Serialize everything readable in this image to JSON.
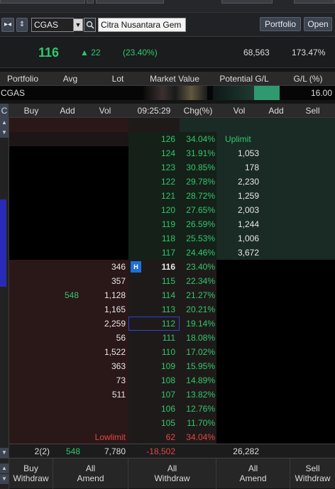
{
  "toolbar": {
    "symbol": "CGAS",
    "search_icon": "search-icon",
    "company_name": "Citra Nusantara Gem",
    "portfolio_label": "Portfolio",
    "open_label": "Open"
  },
  "quote": {
    "price": "116",
    "change": "▲ 22",
    "change_pct": "(23.40%)",
    "volume": "68,563",
    "pct2": "173.47%"
  },
  "portfolio_header": {
    "portfolio": "Portfolio",
    "avg": "Avg",
    "lot": "Lot",
    "market_value": "Market Value",
    "potential": "Potential G/L",
    "gl_pct": "G/L (%)"
  },
  "portfolio_row": {
    "code": "CGAS",
    "gl_pct": "16.00"
  },
  "book_header": {
    "c_btn": "C",
    "buy": "Buy",
    "add": "Add",
    "vol": "Vol",
    "time": "09:25:29",
    "chg": "Chg(%)",
    "vol2": "Vol",
    "add2": "Add",
    "sell": "Sell"
  },
  "book_rows": [
    {
      "price": "126",
      "chg": "34.04%",
      "ask_vol": "Uplimit"
    },
    {
      "price": "124",
      "chg": "31.91%",
      "ask_vol": "1,053"
    },
    {
      "price": "123",
      "chg": "30.85%",
      "ask_vol": "178"
    },
    {
      "price": "122",
      "chg": "29.78%",
      "ask_vol": "2,230"
    },
    {
      "price": "121",
      "chg": "28.72%",
      "ask_vol": "1,259"
    },
    {
      "price": "120",
      "chg": "27.65%",
      "ask_vol": "2,003"
    },
    {
      "price": "119",
      "chg": "26.59%",
      "ask_vol": "1,244"
    },
    {
      "price": "118",
      "chg": "25.53%",
      "ask_vol": "1,006"
    },
    {
      "price": "117",
      "chg": "24.46%",
      "ask_vol": "3,672"
    },
    {
      "price": "116",
      "chg": "23.40%",
      "bid_vol": "346",
      "badge": "H"
    },
    {
      "price": "115",
      "chg": "22.34%",
      "bid_vol": "357"
    },
    {
      "price": "114",
      "chg": "21.27%",
      "bid_vol": "1,128",
      "add": "548"
    },
    {
      "price": "113",
      "chg": "20.21%",
      "bid_vol": "1,165"
    },
    {
      "price": "112",
      "chg": "19.14%",
      "bid_vol": "2,259"
    },
    {
      "price": "111",
      "chg": "18.08%",
      "bid_vol": "56"
    },
    {
      "price": "110",
      "chg": "17.02%",
      "bid_vol": "1,522"
    },
    {
      "price": "109",
      "chg": "15.95%",
      "bid_vol": "363"
    },
    {
      "price": "108",
      "chg": "14.89%",
      "bid_vol": "73"
    },
    {
      "price": "107",
      "chg": "13.82%",
      "bid_vol": "511"
    },
    {
      "price": "106",
      "chg": "12.76%"
    },
    {
      "price": "105",
      "chg": "11.70%"
    },
    {
      "price": "62",
      "chg": "34.04%",
      "bid_vol": "Lowlimit"
    }
  ],
  "totals": {
    "buy": "2(2)",
    "add": "548",
    "vol": "7,780",
    "net": "-18,502",
    "ask_vol": "26,282"
  },
  "bottom_buttons": {
    "b1_l1": "Buy",
    "b1_l2": "Withdraw",
    "b2_l1": "All",
    "b2_l2": "Amend",
    "b3_l1": "All",
    "b3_l2": "Withdraw",
    "b4_l1": "All",
    "b4_l2": "Amend",
    "b5_l1": "Sell",
    "b5_l2": "Withdraw"
  },
  "colors": {
    "up": "#2ec96b",
    "down": "#e04646",
    "badge": "#1f6fd8"
  }
}
